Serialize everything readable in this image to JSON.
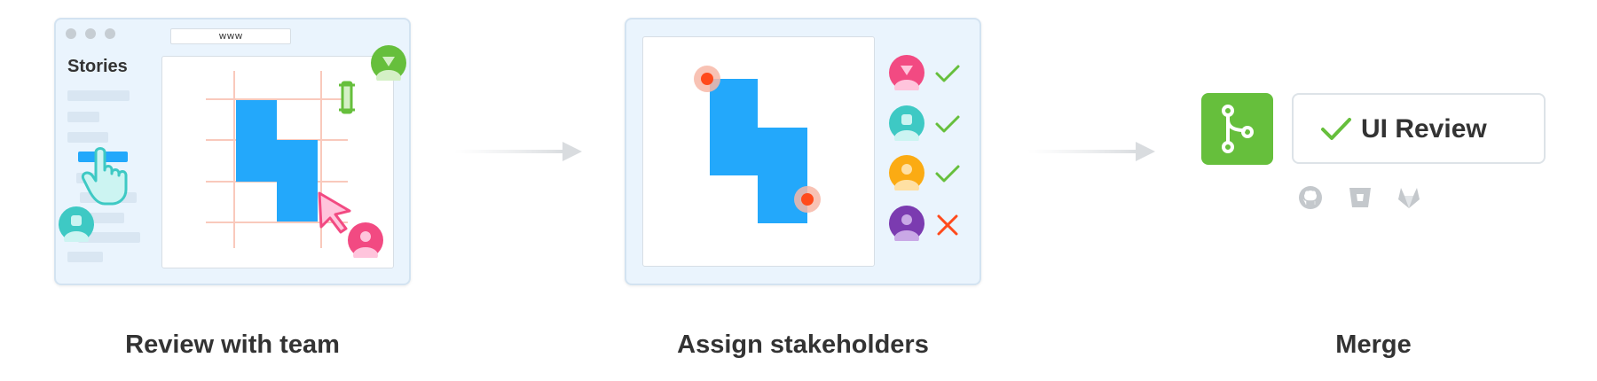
{
  "steps": [
    {
      "label": "Review with team"
    },
    {
      "label": "Assign stakeholders"
    },
    {
      "label": "Merge"
    }
  ],
  "browser": {
    "url": "www",
    "sidebar_title": "Stories"
  },
  "review": {
    "label": "UI Review"
  },
  "stakeholders": [
    {
      "color": "#f24a82",
      "status": "approved"
    },
    {
      "color": "#3ec9c4",
      "status": "approved"
    },
    {
      "color": "#fbab13",
      "status": "approved"
    },
    {
      "color": "#7b3bb0",
      "status": "rejected"
    }
  ],
  "providers": [
    "github-icon",
    "bitbucket-icon",
    "gitlab-icon"
  ],
  "colors": {
    "accent_blue": "#23a8fb",
    "merge_green": "#66bf3c",
    "check_green": "#66bf3c",
    "reject_red": "#ff4a1c",
    "guide_pink": "#f9c9bc"
  }
}
